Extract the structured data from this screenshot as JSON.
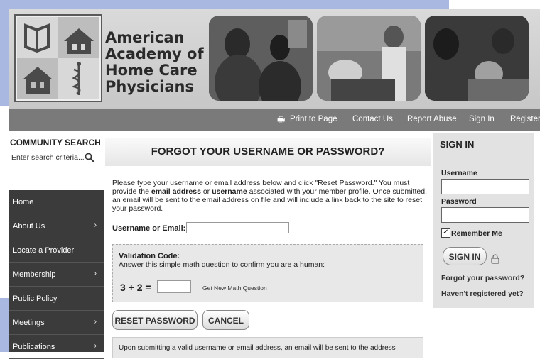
{
  "org": {
    "line1": "American",
    "line2": "Academy of",
    "line3": "Home Care",
    "line4": "Physicians"
  },
  "nav": {
    "print": "Print to Page",
    "contact": "Contact Us",
    "report": "Report Abuse",
    "signin": "Sign In",
    "register": "Register"
  },
  "search": {
    "title": "COMMUNITY SEARCH",
    "placeholder": "Enter search criteria..."
  },
  "leftnav": {
    "items": [
      {
        "label": "Home",
        "arrow": ""
      },
      {
        "label": "About Us",
        "arrow": "›"
      },
      {
        "label": "Locate a Provider",
        "arrow": ""
      },
      {
        "label": "Membership",
        "arrow": "›"
      },
      {
        "label": "Public Policy",
        "arrow": ""
      },
      {
        "label": "Meetings",
        "arrow": "›"
      },
      {
        "label": "Publications",
        "arrow": "›"
      }
    ]
  },
  "main": {
    "title": "FORGOT YOUR USERNAME OR PASSWORD?",
    "intro_a": "Please type your username or email address below and click \"Reset Password.\" You must provide the ",
    "intro_b": "email address",
    "intro_c": " or ",
    "intro_d": "username",
    "intro_e": " associated with your member profile. Once submitted, an email will be sent to the email address on file and will include a link back to the site to reset your password.",
    "field_label": "Username or Email:",
    "val_title": "Validation Code:",
    "val_desc": "Answer this simple math question to confirm you are a human:",
    "math": "3 + 2 =",
    "new_q": "Get New Math Question",
    "reset_btn": "RESET PASSWORD",
    "cancel_btn": "CANCEL",
    "footer_note": "Upon submitting a valid username or email address, an email will be sent to the address"
  },
  "signin": {
    "title": "SIGN IN",
    "username_label": "Username",
    "password_label": "Password",
    "remember": "Remember Me",
    "button": "SIGN IN",
    "forgot": "Forgot your password?",
    "register": "Haven't registered yet?"
  }
}
